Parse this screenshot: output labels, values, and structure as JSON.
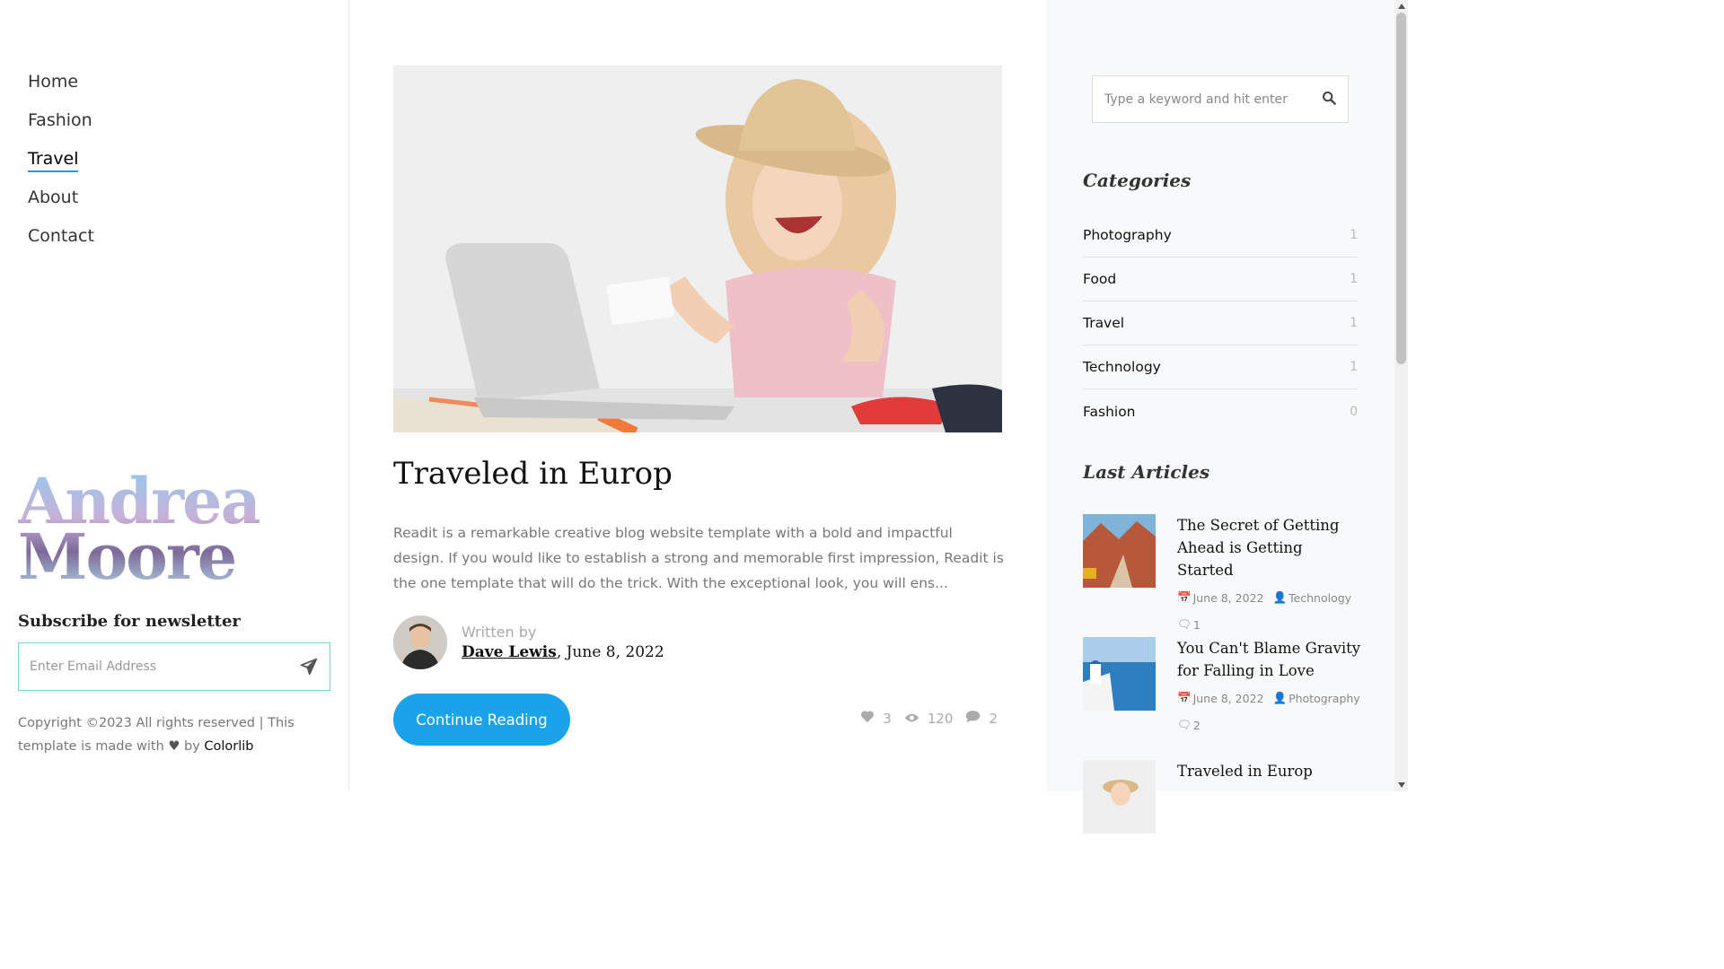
{
  "nav": {
    "items": [
      {
        "label": "Home",
        "active": false
      },
      {
        "label": "Fashion",
        "active": false
      },
      {
        "label": "Travel",
        "active": true
      },
      {
        "label": "About",
        "active": false
      },
      {
        "label": "Contact",
        "active": false
      }
    ]
  },
  "brand": {
    "line1": "Andrea",
    "line2": "Moore"
  },
  "newsletter": {
    "title": "Subscribe for newsletter",
    "placeholder": "Enter Email Address"
  },
  "footer": {
    "copyright_prefix": "Copyright ©2023 All rights reserved | This template is made with",
    "by": "by",
    "link": "Colorlib"
  },
  "post": {
    "title": "Traveled in Europ",
    "excerpt": "Readit is a remarkable creative blog website template with a bold and impactful design. If you would like to establish a strong and memorable first impression, Readit is the one template that will do the trick. With the exceptional look, you will ens...",
    "written_by": "Written by",
    "author": "Dave Lewis",
    "date": ", June 8, 2022",
    "continue_label": "Continue Reading",
    "likes": "3",
    "views": "120",
    "comments": "2"
  },
  "search": {
    "placeholder": "Type a keyword and hit enter"
  },
  "categories": {
    "title": "Categories",
    "items": [
      {
        "name": "Photography",
        "count": "1"
      },
      {
        "name": "Food",
        "count": "1"
      },
      {
        "name": "Travel",
        "count": "1"
      },
      {
        "name": "Technology",
        "count": "1"
      },
      {
        "name": "Fashion",
        "count": "0"
      }
    ]
  },
  "last_articles": {
    "title": "Last Articles",
    "items": [
      {
        "title": "The Secret of Getting Ahead is Getting Started",
        "date": "June 8, 2022",
        "category": "Technology",
        "comments": "1"
      },
      {
        "title": "You Can't Blame Gravity for Falling in Love",
        "date": "June 8, 2022",
        "category": "Photography",
        "comments": "2"
      },
      {
        "title": "Traveled in Europ",
        "date": "",
        "category": "",
        "comments": ""
      }
    ]
  },
  "colors": {
    "accent": "#1aa3e8",
    "nav_underline": "#1e9ce8"
  }
}
